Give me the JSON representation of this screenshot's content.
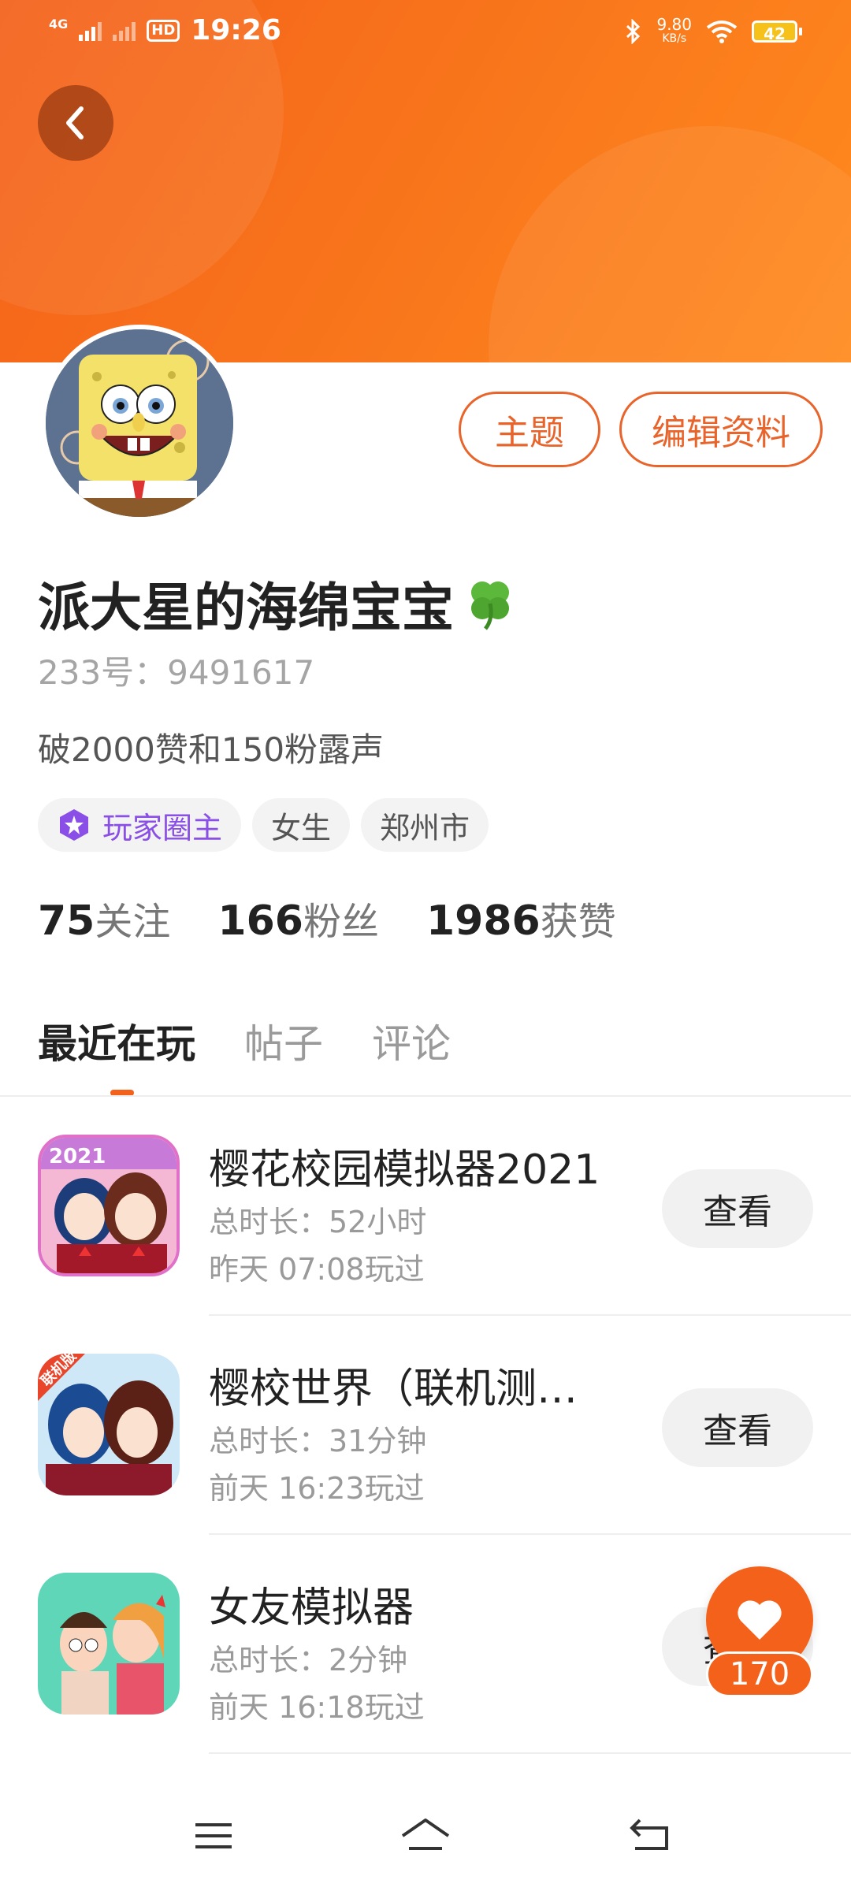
{
  "status_bar": {
    "network": "4G",
    "hd": "HD",
    "time": "19:26",
    "speed": "9.80",
    "speed_unit": "KB/s",
    "battery": "42"
  },
  "colors": {
    "accent": "#f4611a",
    "vip": "#8a4fe6"
  },
  "profile": {
    "name": "派大星的海绵宝宝",
    "name_emoji_icon": "four-leaf-clover-icon",
    "uid": "233号：9491617",
    "bio": "破2000赞和150粉露声",
    "tags": [
      "玩家圈主",
      "女生",
      "郑州市"
    ],
    "theme_button": "主题",
    "edit_button": "编辑资料"
  },
  "stats": [
    {
      "num": "75",
      "label": "关注"
    },
    {
      "num": "166",
      "label": "粉丝"
    },
    {
      "num": "1986",
      "label": "获赞"
    }
  ],
  "tabs": [
    "最近在玩",
    "帖子",
    "评论"
  ],
  "games": [
    {
      "title": "樱花校园模拟器2021",
      "duration": "总时长：52小时",
      "last_played": "昨天 07:08玩过",
      "button": "查看",
      "icon_badge": "2021"
    },
    {
      "title": "樱校世界（联机测…",
      "duration": "总时长：31分钟",
      "last_played": "前天 16:23玩过",
      "button": "查看",
      "icon_badge": "联机版"
    },
    {
      "title": "女友模拟器",
      "duration": "总时长：2分钟",
      "last_played": "前天 16:18玩过",
      "button": "查看",
      "icon_badge": ""
    }
  ],
  "like_fab": {
    "count": "170"
  }
}
